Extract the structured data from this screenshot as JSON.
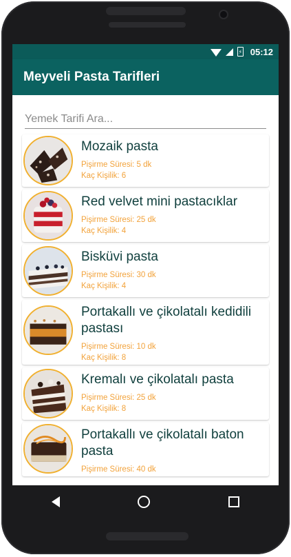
{
  "status_bar": {
    "time": "05:12"
  },
  "app_bar": {
    "title": "Meyveli Pasta Tarifleri"
  },
  "search": {
    "placeholder": "Yemek Tarifi Ara..."
  },
  "recipes": [
    {
      "title": "Mozaik pasta",
      "cook_time": "Pişirme Süresi: 5 dk",
      "servings": "Kaç Kişilik: 6"
    },
    {
      "title": "Red velvet mini pastacıklar",
      "cook_time": "Pişirme Süresi: 25 dk",
      "servings": "Kaç Kişilik: 4"
    },
    {
      "title": "Bisküvi pasta",
      "cook_time": "Pişirme Süresi: 30 dk",
      "servings": "Kaç Kişilik: 4"
    },
    {
      "title": "Portakallı ve çikolatalı kedidili pastası",
      "cook_time": "Pişirme Süresi: 10 dk",
      "servings": "Kaç Kişilik: 8"
    },
    {
      "title": "Kremalı ve çikolatalı pasta",
      "cook_time": "Pişirme Süresi: 25 dk",
      "servings": "Kaç Kişilik: 8"
    },
    {
      "title": "Portakallı ve çikolatalı baton pasta",
      "cook_time": "Pişirme Süresi: 40 dk",
      "servings": ""
    }
  ],
  "colors": {
    "primary": "#0b6260",
    "status_bar": "#0b5b59",
    "accent": "#f2a23a",
    "title_text": "#11403e"
  },
  "icons": {
    "status": [
      "wifi-icon",
      "signal-icon",
      "battery-icon"
    ],
    "nav": [
      "back-icon",
      "home-icon",
      "recent-apps-icon"
    ]
  }
}
